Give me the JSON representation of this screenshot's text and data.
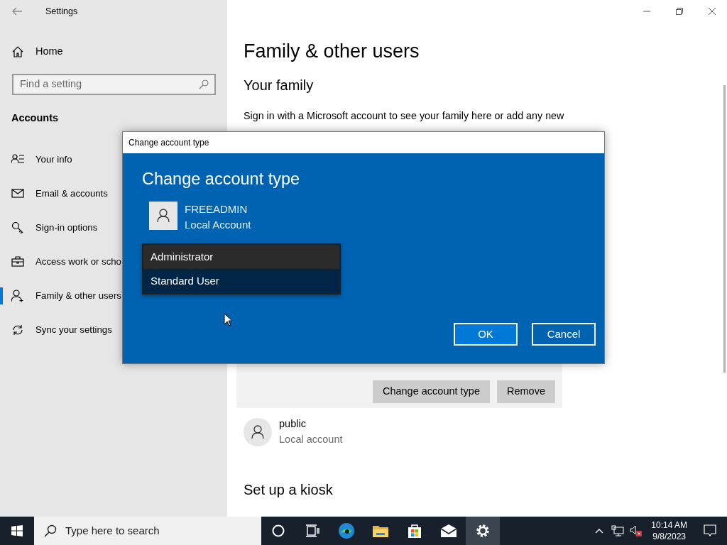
{
  "window": {
    "title": "Settings"
  },
  "sidebar": {
    "home": "Home",
    "search": {
      "placeholder": "Find a setting"
    },
    "section": "Accounts",
    "items": [
      {
        "label": "Your info",
        "selected": false
      },
      {
        "label": "Email & accounts",
        "selected": false
      },
      {
        "label": "Sign-in options",
        "selected": false
      },
      {
        "label": "Access work or scho",
        "selected": false
      },
      {
        "label": "Family & other users",
        "selected": true
      },
      {
        "label": "Sync your settings",
        "selected": false
      }
    ]
  },
  "main": {
    "title": "Family & other users",
    "family_heading": "Your family",
    "family_text": "Sign in with a Microsoft account to see your family here or add any new",
    "card_buttons": [
      "Change account type",
      "Remove"
    ],
    "other_users": [
      {
        "name": "public",
        "type": "Local account"
      }
    ],
    "kiosk_heading": "Set up a kiosk"
  },
  "dialog": {
    "title": "Change account type",
    "heading": "Change account type",
    "account": {
      "name": "FREEADMIN",
      "type": "Local Account"
    },
    "account_types": [
      {
        "label": "Administrator",
        "selected": false
      },
      {
        "label": "Standard User",
        "selected": true
      }
    ],
    "buttons": [
      "OK",
      "Cancel"
    ]
  },
  "taskbar": {
    "search": {
      "placeholder": "Type here to search"
    },
    "apps": [
      {
        "selected": false
      },
      {
        "selected": false
      },
      {
        "selected": false
      },
      {
        "selected": false
      },
      {
        "selected": false
      },
      {
        "selected": false
      },
      {
        "selected": true
      }
    ],
    "clock": {
      "time": "10:14 AM",
      "date": "9/8/2023"
    }
  }
}
